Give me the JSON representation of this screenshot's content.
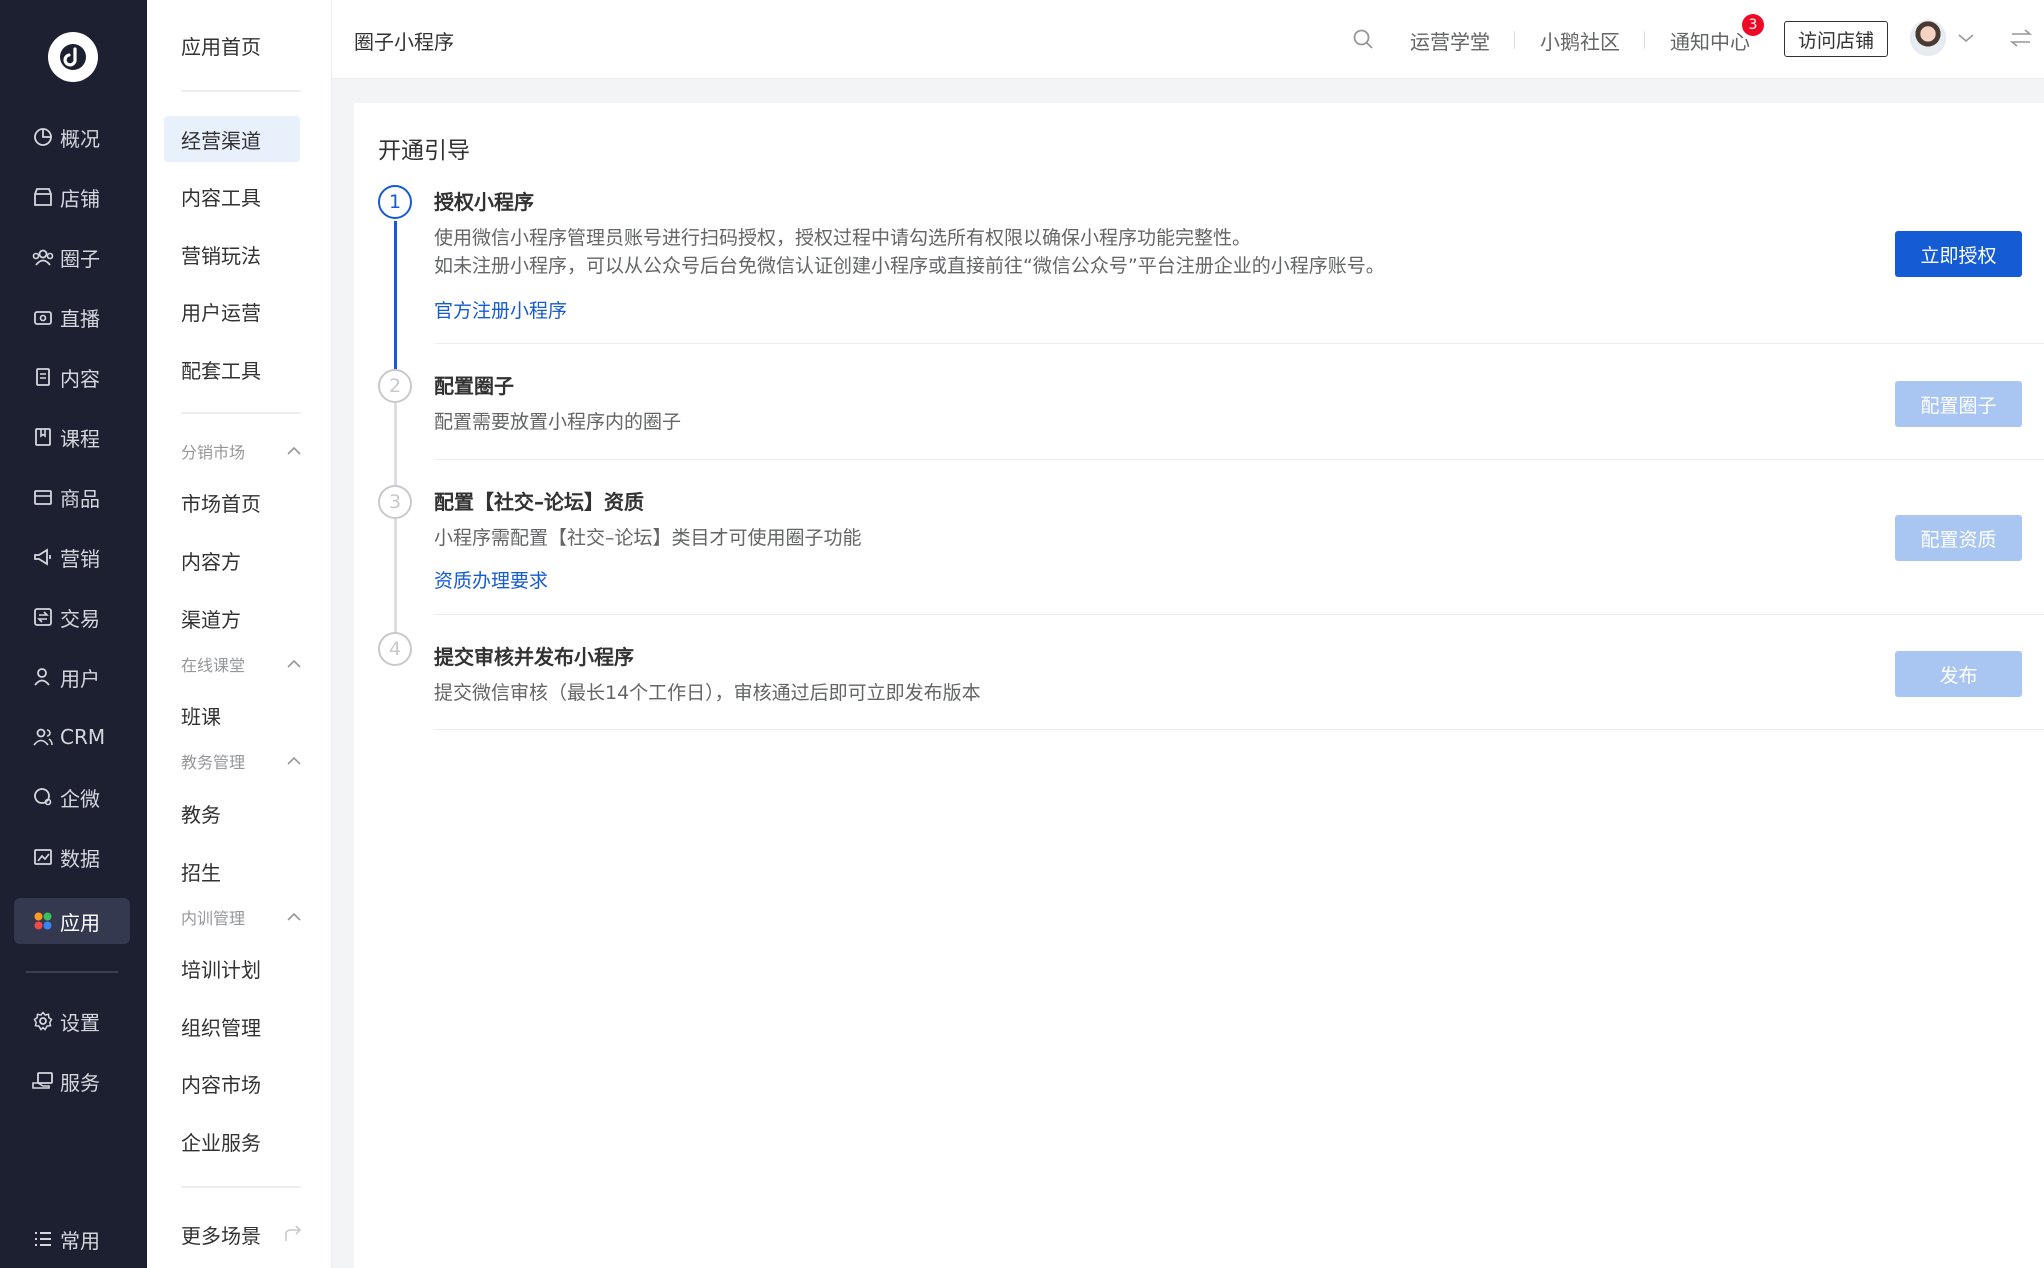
{
  "nav": {
    "items": [
      {
        "label": "概况",
        "icon": "overview-icon"
      },
      {
        "label": "店铺",
        "icon": "store-icon"
      },
      {
        "label": "圈子",
        "icon": "circle-icon"
      },
      {
        "label": "直播",
        "icon": "live-icon"
      },
      {
        "label": "内容",
        "icon": "content-icon"
      },
      {
        "label": "课程",
        "icon": "course-icon"
      },
      {
        "label": "商品",
        "icon": "goods-icon"
      },
      {
        "label": "营销",
        "icon": "marketing-icon"
      },
      {
        "label": "交易",
        "icon": "trade-icon"
      },
      {
        "label": "用户",
        "icon": "user-icon"
      },
      {
        "label": "CRM",
        "icon": "crm-icon"
      },
      {
        "label": "企微",
        "icon": "wecom-icon"
      },
      {
        "label": "数据",
        "icon": "data-icon"
      },
      {
        "label": "应用",
        "icon": "apps-icon",
        "active": true
      },
      {
        "label": "设置",
        "icon": "settings-icon"
      },
      {
        "label": "服务",
        "icon": "service-icon"
      },
      {
        "label": "常用",
        "icon": "common-icon"
      }
    ]
  },
  "subnav": {
    "home": "应用首页",
    "items": [
      "经营渠道",
      "内容工具",
      "营销玩法",
      "用户运营",
      "配套工具"
    ],
    "group_distribution": "分销市场",
    "distribution_items": [
      "市场首页",
      "内容方",
      "渠道方"
    ],
    "group_online": "在线课堂",
    "online_items": [
      "班课"
    ],
    "group_edu": "教务管理",
    "edu_items": [
      "教务",
      "招生"
    ],
    "group_training": "内训管理",
    "training_items": [
      "培训计划",
      "组织管理",
      "内容市场",
      "企业服务"
    ],
    "more": "更多场景"
  },
  "header": {
    "title": "圈子小程序",
    "links": [
      "运营学堂",
      "小鹅社区",
      "通知中心"
    ],
    "notify_count": "3",
    "visit_store": "访问店铺"
  },
  "guide": {
    "title": "开通引导",
    "steps": [
      {
        "num": "1",
        "title": "授权小程序",
        "desc1": "使用微信小程序管理员账号进行扫码授权，授权过程中请勾选所有权限以确保小程序功能完整性。",
        "desc2": "如未注册小程序，可以从公众号后台免微信认证创建小程序或直接前往“微信公众号”平台注册企业的小程序账号。",
        "link": "官方注册小程序",
        "button": "立即授权"
      },
      {
        "num": "2",
        "title": "配置圈子",
        "desc1": "配置需要放置小程序内的圈子",
        "button": "配置圈子"
      },
      {
        "num": "3",
        "title": "配置【社交–论坛】资质",
        "desc1": "小程序需配置【社交–论坛】类目才可使用圈子功能",
        "link": "资质办理要求",
        "button": "配置资质"
      },
      {
        "num": "4",
        "title": "提交审核并发布小程序",
        "desc1": "提交微信审核（最长14个工作日），审核通过后即可立即发布版本",
        "button": "发布"
      }
    ]
  },
  "colors": {
    "primary": "#155bd4",
    "primary_disabled": "#a9c6f2",
    "nav_bg": "#1d2030",
    "badge": "#ee0a24"
  }
}
